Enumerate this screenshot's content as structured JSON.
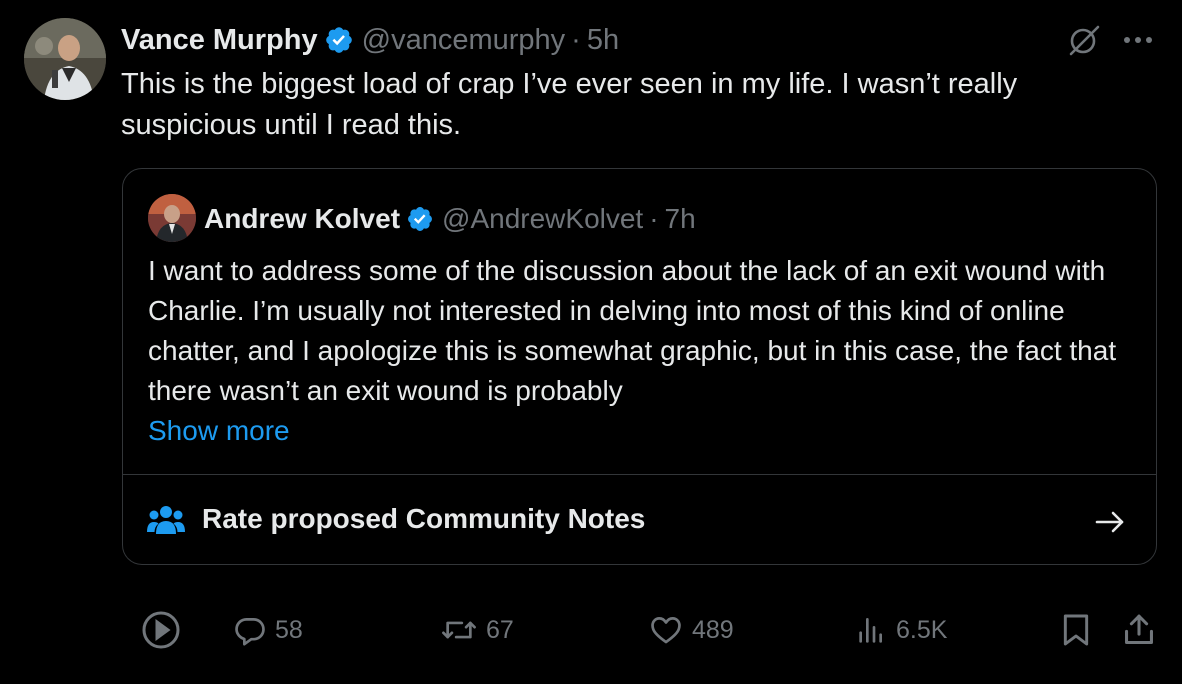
{
  "author": {
    "name": "Vance Murphy",
    "handle": "@vancemurphy",
    "separator": "·",
    "time": "5h"
  },
  "tweet_text": "This is the biggest load of crap I’ve ever seen in my life. I wasn’t really suspicious until I read this.",
  "quote": {
    "name": "Andrew Kolvet",
    "handle": "@AndrewKolvet",
    "separator": "·",
    "time": "7h",
    "text": "I want to address some of the discussion about the lack of an exit wound with Charlie. I’m usually not interested in delving into most of this kind of online chatter, and I apologize this is somewhat graphic, but in this case, the fact that there wasn’t an exit wound is probably",
    "show_more": "Show more",
    "community_notes_label": "Rate proposed Community Notes"
  },
  "actions": {
    "replies": "58",
    "reposts": "67",
    "likes": "489",
    "views": "6.5K"
  },
  "icons": {
    "verified": "verified-badge-icon",
    "grok": "grok-icon",
    "more": "more-icon",
    "community": "people-icon",
    "arrow": "arrow-right-icon",
    "play": "play-icon",
    "reply": "reply-icon",
    "repost": "repost-icon",
    "like": "heart-icon",
    "views": "views-icon",
    "bookmark": "bookmark-icon",
    "share": "share-icon"
  },
  "colors": {
    "background": "#000000",
    "text": "#e7e9ea",
    "muted": "#71767b",
    "accent": "#1d9bf0",
    "border": "#333639"
  }
}
